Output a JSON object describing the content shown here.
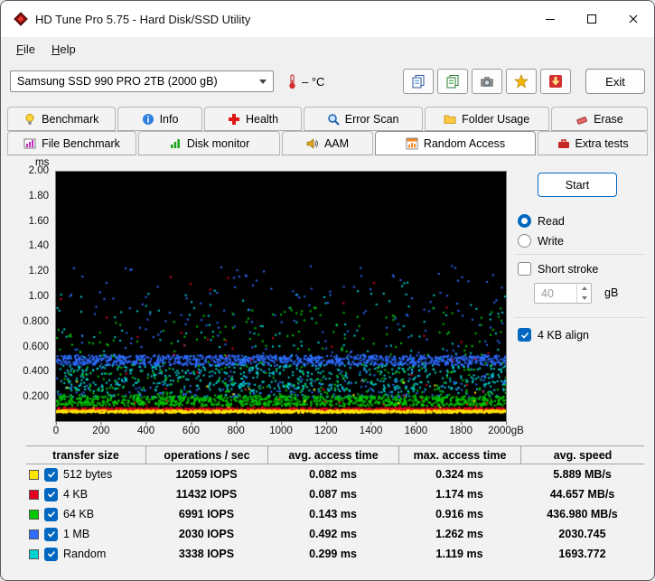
{
  "window": {
    "title": "HD Tune Pro 5.75 - Hard Disk/SSD Utility"
  },
  "menu": {
    "file": "File",
    "help": "Help"
  },
  "toolbar": {
    "drive": "Samsung SSD 990 PRO 2TB (2000 gB)",
    "temperature": "– °C",
    "exit_label": "Exit"
  },
  "tabs": {
    "row1": [
      {
        "label": "Benchmark"
      },
      {
        "label": "Info"
      },
      {
        "label": "Health"
      },
      {
        "label": "Error Scan"
      },
      {
        "label": "Folder Usage"
      },
      {
        "label": "Erase"
      }
    ],
    "row2": [
      {
        "label": "File Benchmark"
      },
      {
        "label": "Disk monitor"
      },
      {
        "label": "AAM"
      },
      {
        "label": "Random Access",
        "active": true
      },
      {
        "label": "Extra tests"
      }
    ]
  },
  "panel": {
    "start_label": "Start",
    "read_label": "Read",
    "write_label": "Write",
    "read_selected": true,
    "short_stroke_label": "Short stroke",
    "short_stroke_checked": false,
    "short_stroke_value": "40",
    "short_stroke_unit": "gB",
    "align_label": "4 KB align",
    "align_checked": true,
    "accent_color": "#0067c0"
  },
  "chart_data": {
    "type": "scatter",
    "title": "Random Access read test - access time vs disk position",
    "x_range": [
      0,
      2000
    ],
    "x_ticks": [
      "0",
      "200",
      "400",
      "600",
      "800",
      "1000",
      "1200",
      "1400",
      "1600",
      "1800",
      "2000gB"
    ],
    "y_unit": "ms",
    "y_range": [
      0,
      2.0
    ],
    "y_ticks": [
      "2.00",
      "1.80",
      "1.60",
      "1.40",
      "1.20",
      "1.00",
      "0.800",
      "0.600",
      "0.400",
      "0.200"
    ],
    "grid": false,
    "background": "#000000",
    "legend_position": "table-below",
    "series": [
      {
        "name": "512 bytes",
        "color": "#ffe600",
        "avg_access_ms": 0.082,
        "max_access_ms": 0.324,
        "iops": 12059,
        "avg_speed": "5.889 MB/s",
        "band": [
          0.072,
          0.094
        ],
        "points": 1200,
        "outliers": 18,
        "outlier_range": [
          0.095,
          0.324
        ]
      },
      {
        "name": "4 KB",
        "color": "#e1001e",
        "avg_access_ms": 0.087,
        "max_access_ms": 1.174,
        "iops": 11432,
        "avg_speed": "44.657 MB/s",
        "band": [
          0.084,
          0.112
        ],
        "points": 1200,
        "outliers": 55,
        "outlier_range": [
          0.115,
          1.174
        ]
      },
      {
        "name": "64 KB",
        "color": "#00c800",
        "avg_access_ms": 0.143,
        "max_access_ms": 0.916,
        "iops": 6991,
        "avg_speed": "436.980 MB/s",
        "band": [
          0.128,
          0.205
        ],
        "points": 1000,
        "outliers": 330,
        "outlier_range": [
          0.205,
          0.916
        ]
      },
      {
        "name": "1 MB",
        "color": "#2e6bff",
        "avg_access_ms": 0.492,
        "max_access_ms": 1.262,
        "iops": 2030,
        "avg_speed": "2030.745",
        "band": [
          0.455,
          0.535
        ],
        "points": 1100,
        "outliers": 330,
        "outlier_range": [
          0.2,
          1.262
        ]
      },
      {
        "name": "Random",
        "color": "#00d2d2",
        "avg_access_ms": 0.299,
        "max_access_ms": 1.119,
        "iops": 3338,
        "avg_speed": "1693.772",
        "band": [
          0.24,
          0.46
        ],
        "points": 520,
        "outliers": 260,
        "outlier_range": [
          0.2,
          1.119
        ]
      }
    ]
  },
  "table": {
    "headers": [
      "transfer size",
      "operations / sec",
      "avg. access time",
      "max. access time",
      "avg. speed"
    ],
    "rows": [
      {
        "color": "#ffe600",
        "checked": true,
        "label": "512 bytes",
        "ops": "12059 IOPS",
        "avg": "0.082 ms",
        "max": "0.324 ms",
        "speed": "5.889 MB/s"
      },
      {
        "color": "#e1001e",
        "checked": true,
        "label": "4 KB",
        "ops": "11432 IOPS",
        "avg": "0.087 ms",
        "max": "1.174 ms",
        "speed": "44.657 MB/s"
      },
      {
        "color": "#00c800",
        "checked": true,
        "label": "64 KB",
        "ops": "6991 IOPS",
        "avg": "0.143 ms",
        "max": "0.916 ms",
        "speed": "436.980 MB/s"
      },
      {
        "color": "#2e6bff",
        "checked": true,
        "label": "1 MB",
        "ops": "2030 IOPS",
        "avg": "0.492 ms",
        "max": "1.262 ms",
        "speed": "2030.745"
      },
      {
        "color": "#00d2d2",
        "checked": true,
        "label": "Random",
        "ops": "3338 IOPS",
        "avg": "0.299 ms",
        "max": "1.119 ms",
        "speed": "1693.772"
      }
    ]
  }
}
